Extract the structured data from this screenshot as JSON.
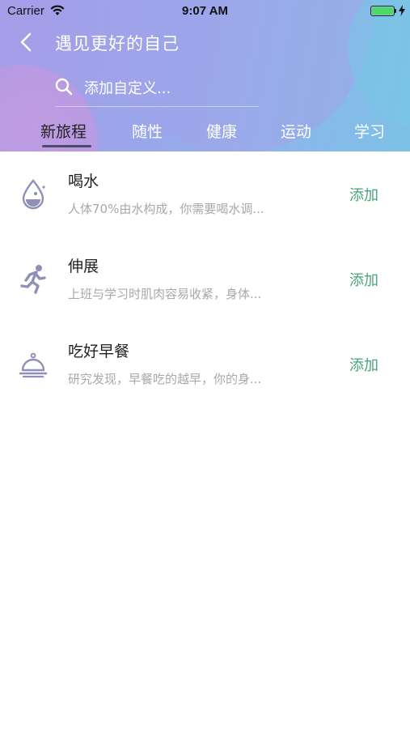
{
  "status_bar": {
    "carrier": "Carrier",
    "time": "9:07 AM"
  },
  "nav": {
    "title": "遇见更好的自己"
  },
  "search": {
    "placeholder": "添加自定义..."
  },
  "tabs": [
    {
      "label": "新旅程",
      "active": true
    },
    {
      "label": "随性",
      "active": false
    },
    {
      "label": "健康",
      "active": false
    },
    {
      "label": "运动",
      "active": false
    },
    {
      "label": "学习",
      "active": false
    }
  ],
  "items": [
    {
      "icon": "water-drop-icon",
      "title": "喝水",
      "desc": "人体70%由水构成，你需要喝水调...",
      "action": "添加"
    },
    {
      "icon": "running-person-icon",
      "title": "伸展",
      "desc": "上班与学习时肌肉容易收紧，身体...",
      "action": "添加"
    },
    {
      "icon": "food-cloche-icon",
      "title": "吃好早餐",
      "desc": "研究发现，早餐吃的越早，你的身...",
      "action": "添加"
    }
  ],
  "colors": {
    "accent_green": "#4aa37a",
    "icon_purple": "#8f8fb8"
  }
}
